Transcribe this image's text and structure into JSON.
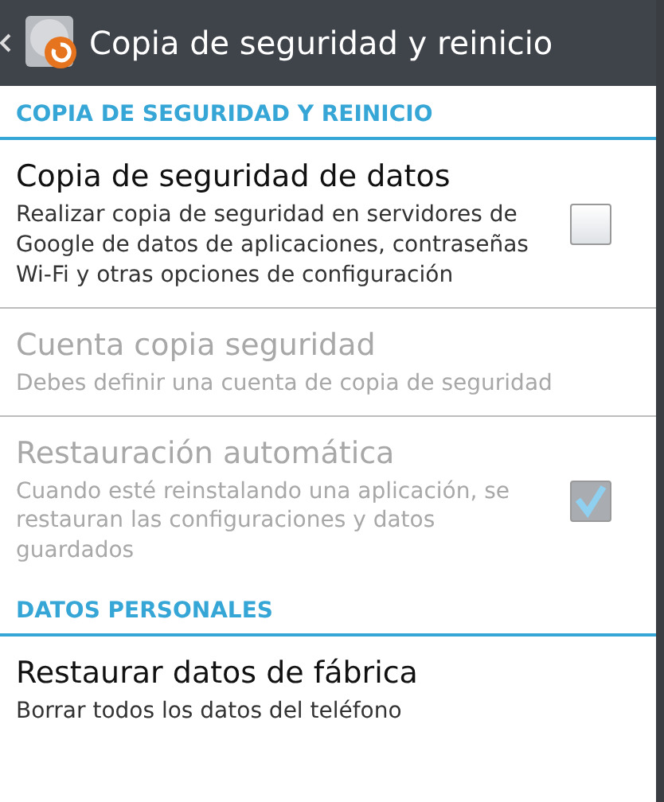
{
  "action_bar": {
    "title": "Copia de seguridad y reinicio"
  },
  "sections": [
    {
      "header": "COPIA DE SEGURIDAD Y REINICIO",
      "items": [
        {
          "kind": "checkbox",
          "title": "Copia de seguridad de datos",
          "summary": "Realizar copia de seguridad en servidores de Google de datos de aplicaciones, contraseñas Wi-Fi y otras opciones de configuración",
          "disabled": false,
          "checked": false
        },
        {
          "kind": "plain",
          "title": "Cuenta copia seguridad",
          "summary": "Debes definir una cuenta de copia de seguridad",
          "disabled": true
        },
        {
          "kind": "checkbox",
          "title": "Restauración automática",
          "summary": "Cuando esté reinstalando una aplicación, se restauran las configuraciones y datos guardados",
          "disabled": true,
          "checked": true
        }
      ]
    },
    {
      "header": "DATOS PERSONALES",
      "items": [
        {
          "kind": "plain",
          "title": "Restaurar datos de fábrica",
          "summary": "Borrar todos los datos del teléfono",
          "disabled": false
        }
      ]
    }
  ]
}
